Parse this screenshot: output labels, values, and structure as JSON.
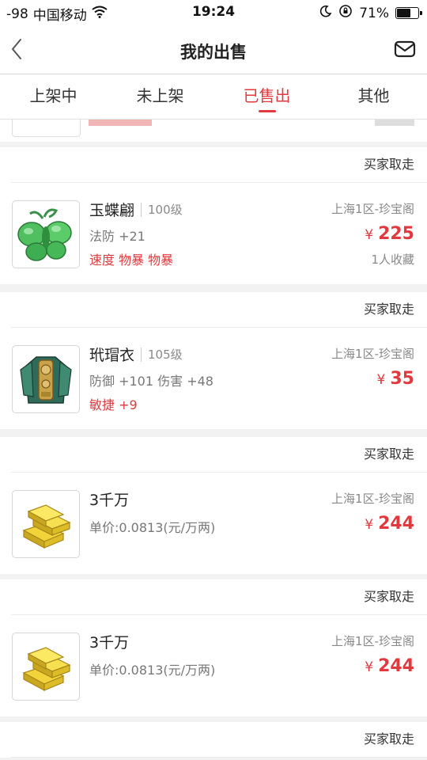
{
  "status_bar": {
    "signal": "-98",
    "carrier": "中国移动",
    "time": "19:24",
    "battery": "71%",
    "battery_level": 0.71
  },
  "navbar": {
    "title": "我的出售"
  },
  "tabs": [
    {
      "label": "上架中",
      "active": false
    },
    {
      "label": "未上架",
      "active": false
    },
    {
      "label": "已售出",
      "active": true
    },
    {
      "label": "其他",
      "active": false
    }
  ],
  "colors": {
    "accent": "#e0393e",
    "muted": "#888888",
    "background": "#f2f2f2"
  },
  "items": [
    {
      "status": "买家取走",
      "icon": "jade-butterfly-icon",
      "name": "玉蝶翩",
      "level": "100级",
      "stats": "法防 +21",
      "extra": "速度 物暴 物暴",
      "server": "上海1区-珍宝阁",
      "currency": "¥",
      "price": "225",
      "favorites": "1人收藏"
    },
    {
      "status": "买家取走",
      "icon": "armor-robe-icon",
      "name": "玳瑁衣",
      "level": "105级",
      "stats": "防御 +101 伤害 +48",
      "extra": "敏捷 +9",
      "server": "上海1区-珍宝阁",
      "currency": "¥",
      "price": "35"
    },
    {
      "status": "买家取走",
      "icon": "gold-bars-icon",
      "name": "3千万",
      "stats": "单价:0.0813(元/万两)",
      "server": "上海1区-珍宝阁",
      "currency": "¥",
      "price": "244"
    },
    {
      "status": "买家取走",
      "icon": "gold-bars-icon",
      "name": "3千万",
      "stats": "单价:0.0813(元/万两)",
      "server": "上海1区-珍宝阁",
      "currency": "¥",
      "price": "244"
    },
    {
      "status": "买家取走"
    }
  ]
}
